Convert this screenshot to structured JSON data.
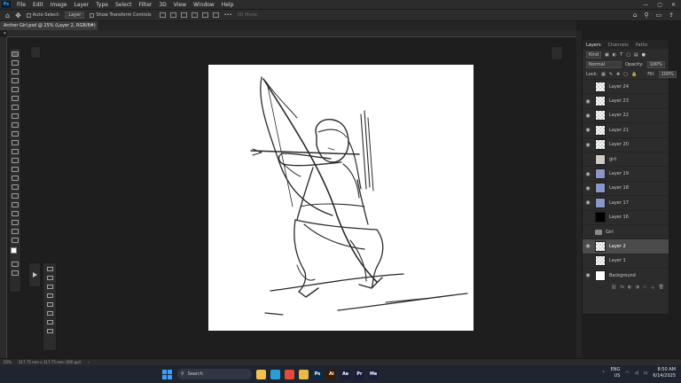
{
  "app": {
    "menu": [
      "File",
      "Edit",
      "Image",
      "Layer",
      "Type",
      "Select",
      "Filter",
      "3D",
      "View",
      "Window",
      "Help"
    ],
    "logo_text": "Ps",
    "window_controls": [
      "—",
      "▢",
      "✕"
    ]
  },
  "options_bar": {
    "auto_select_label": "Auto-Select:",
    "auto_select_value": "Layer",
    "transform_label": "Show Transform Controls",
    "mode_3d_label": "3D Mode:",
    "right_icons": [
      "⌂",
      "⚲",
      "▭",
      "⇪"
    ]
  },
  "document": {
    "tab_title": "Archer Girl.psd @ 25% (Layer 2, RGB/8#) *",
    "tab_close": "×"
  },
  "layers_panel": {
    "tabs": [
      "Layers",
      "Channels",
      "Paths"
    ],
    "active_tab": "Layers",
    "kind_label": "Kind",
    "blend_mode": "Normal",
    "opacity_label": "Opacity:",
    "opacity_value": "100%",
    "lock_label": "Lock:",
    "fill_label": "Fill:",
    "fill_value": "100%",
    "layers": [
      {
        "name": "Layer 24",
        "thumb": "checker",
        "visible": false,
        "selected": false
      },
      {
        "name": "Layer 23",
        "thumb": "checker",
        "visible": true,
        "selected": false
      },
      {
        "name": "Layer 22",
        "thumb": "checker",
        "visible": true,
        "selected": false
      },
      {
        "name": "Layer 21",
        "thumb": "checker",
        "visible": true,
        "selected": false
      },
      {
        "name": "Layer 20",
        "thumb": "checker",
        "visible": true,
        "selected": false
      },
      {
        "name": "girl",
        "thumb": "img",
        "visible": false,
        "selected": false
      },
      {
        "name": "Layer 19",
        "thumb": "blue",
        "visible": true,
        "selected": false
      },
      {
        "name": "Layer 18",
        "thumb": "blue",
        "visible": true,
        "selected": false
      },
      {
        "name": "Layer 17",
        "thumb": "blue",
        "visible": true,
        "selected": false
      },
      {
        "name": "Layer 16",
        "thumb": "black",
        "visible": false,
        "selected": false
      },
      {
        "name": "Girl",
        "thumb": "folder",
        "visible": false,
        "selected": false
      },
      {
        "name": "Layer 2",
        "thumb": "checker",
        "visible": true,
        "selected": true
      },
      {
        "name": "Layer 1",
        "thumb": "checker",
        "visible": false,
        "selected": false
      },
      {
        "name": "Background",
        "thumb": "white",
        "visible": true,
        "selected": false
      }
    ],
    "footer_icons": [
      "⛓",
      "fx",
      "◐",
      "◑",
      "▭",
      "＋",
      "🗑"
    ]
  },
  "status_bar": {
    "zoom": "25%",
    "doc_size": "317.75 mm x 317.75 mm (300 ppi)",
    "arrow": "›"
  },
  "taskbar": {
    "search_placeholder": "Search",
    "apps": [
      {
        "name": "file-explorer",
        "letter": "",
        "color": "#f2c14e"
      },
      {
        "name": "edge",
        "letter": "",
        "color": "#2a9fd6"
      },
      {
        "name": "chrome",
        "letter": "",
        "color": "#e24b3b"
      },
      {
        "name": "folder",
        "letter": "",
        "color": "#e8b84a"
      },
      {
        "name": "photoshop",
        "letter": "Ps",
        "color": "#0a2a4a"
      },
      {
        "name": "illustrator",
        "letter": "Ai",
        "color": "#3a1a00"
      },
      {
        "name": "after-effects",
        "letter": "Ae",
        "color": "#1a1a3a"
      },
      {
        "name": "premiere",
        "letter": "Pr",
        "color": "#1a1a3a"
      },
      {
        "name": "media-encoder",
        "letter": "Me",
        "color": "#1a1a3a"
      }
    ],
    "lang_top": "ENG",
    "lang_bottom": "US",
    "time": "8:50 AM",
    "date": "6/14/2025"
  },
  "colors": {
    "accent": "#31a8ff",
    "canvas": "#ffffff",
    "selected_layer": "#4b4b4b"
  }
}
